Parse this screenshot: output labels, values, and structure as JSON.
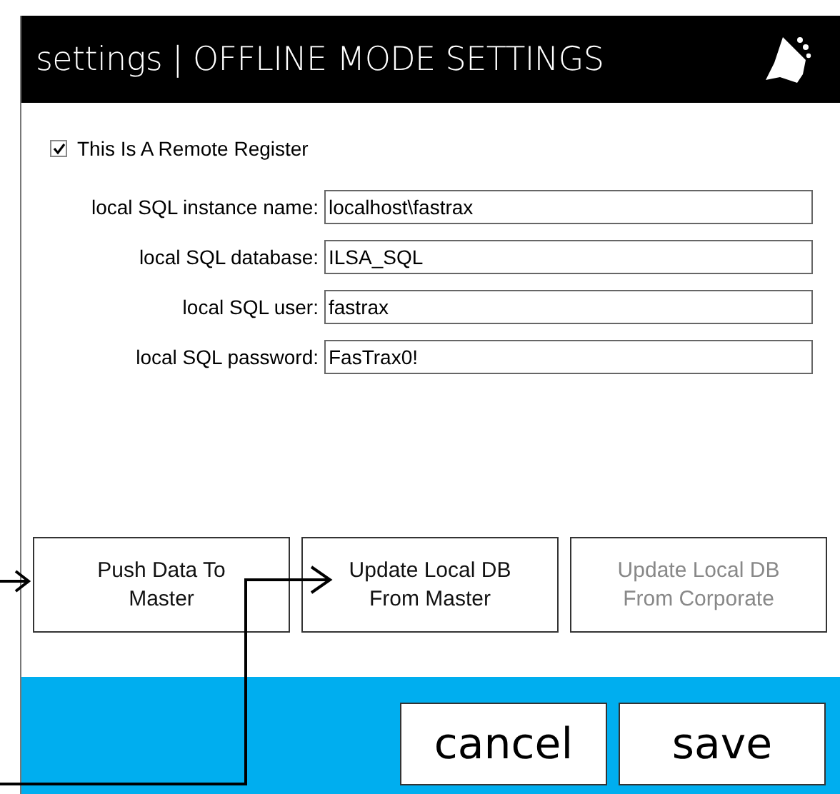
{
  "window": {
    "title": "settings | OFFLINE MODE SETTINGS"
  },
  "remote_register": {
    "label": "This Is A Remote Register",
    "checked": true
  },
  "fields": [
    {
      "label": "local SQL instance name:",
      "value": "localhost\\fastrax"
    },
    {
      "label": "local SQL database:",
      "value": "ILSA_SQL"
    },
    {
      "label": "local SQL user:",
      "value": "fastrax"
    },
    {
      "label": "local SQL password:",
      "value": "FasTrax0!"
    }
  ],
  "actions": [
    {
      "label": "Push Data To Master",
      "disabled": false
    },
    {
      "label": "Update Local DB From Master",
      "disabled": false
    },
    {
      "label": "Update Local DB From Corporate",
      "disabled": true
    }
  ],
  "footer_buttons": [
    "cancel",
    "save"
  ]
}
